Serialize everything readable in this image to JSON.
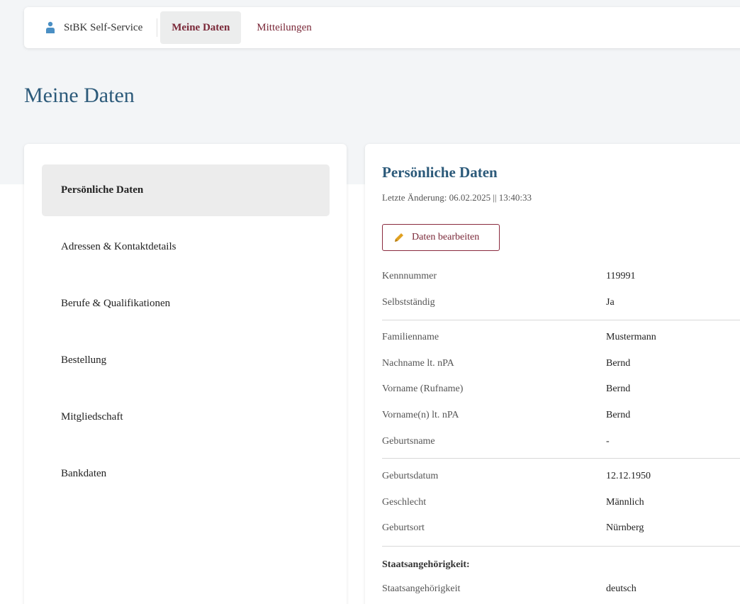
{
  "nav": {
    "brand": "StBK Self-Service",
    "tabs": [
      {
        "label": "Meine Daten",
        "active": true
      },
      {
        "label": "Mitteilungen",
        "active": false
      }
    ]
  },
  "page": {
    "title": "Meine Daten"
  },
  "sidebar": {
    "items": [
      {
        "label": "Persönliche Daten",
        "active": true
      },
      {
        "label": "Adressen & Kontaktdetails"
      },
      {
        "label": "Berufe & Qualifikationen"
      },
      {
        "label": "Bestellung"
      },
      {
        "label": "Mitgliedschaft"
      },
      {
        "label": "Bankdaten"
      }
    ]
  },
  "details": {
    "title": "Persönliche Daten",
    "last_change": "Letzte Änderung: 06.02.2025 || 13:40:33",
    "edit_label": "Daten bearbeiten",
    "rows": [
      {
        "label": "Kennnummer",
        "value": "119991"
      },
      {
        "label": "Selbstständig",
        "value": "Ja"
      },
      {
        "label": "Familienname",
        "value": "Mustermann"
      },
      {
        "label": "Nachname lt. nPA",
        "value": "Bernd"
      },
      {
        "label": "Vorname (Rufname)",
        "value": "Bernd"
      },
      {
        "label": "Vorname(n) lt. nPA",
        "value": "Bernd"
      },
      {
        "label": "Geburtsname",
        "value": "-"
      },
      {
        "label": "Geburtsdatum",
        "value": "12.12.1950"
      },
      {
        "label": "Geschlecht",
        "value": "Männlich"
      },
      {
        "label": "Geburtsort",
        "value": "Nürnberg"
      },
      {
        "label": "Staatsangehörigkeit",
        "value": "deutsch"
      }
    ],
    "nationality_heading": "Staatsangehörigkeit:"
  },
  "colors": {
    "accent": "#7a2838",
    "title_blue": "#2c5a7a",
    "icon_blue": "#4a8fc4",
    "pencil": "#e0a020"
  }
}
